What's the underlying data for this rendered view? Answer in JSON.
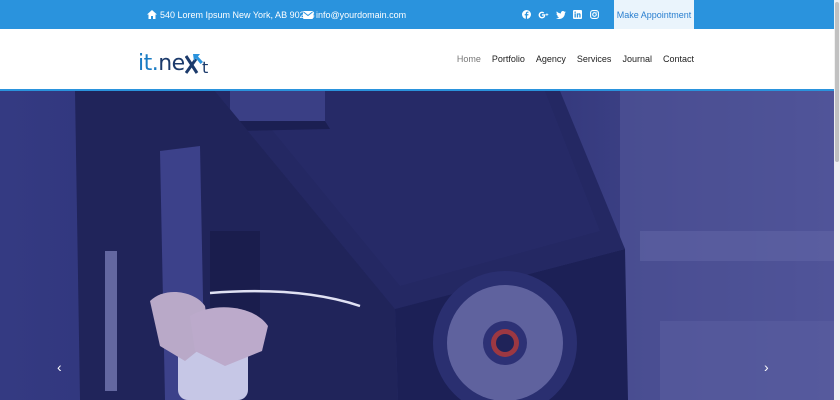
{
  "topbar": {
    "address": "540 Lorem Ipsum New York, AB 90218",
    "email": "info@yourdomain.com",
    "social": [
      "facebook-icon",
      "google-plus-icon",
      "twitter-icon",
      "linkedin-icon",
      "instagram-icon"
    ],
    "appointment": "Make Appointment"
  },
  "brand": {
    "part1": "it.",
    "part2": "ne",
    "part3": "t"
  },
  "nav": {
    "items": [
      "Home",
      "Portfolio",
      "Agency",
      "Services",
      "Journal",
      "Contact"
    ],
    "active": "Home"
  },
  "hero": {
    "prev": "‹",
    "next": "›"
  },
  "colors": {
    "primary": "#2a93dd",
    "overlay": "#2e3280",
    "navy": "#1b3a6b"
  }
}
